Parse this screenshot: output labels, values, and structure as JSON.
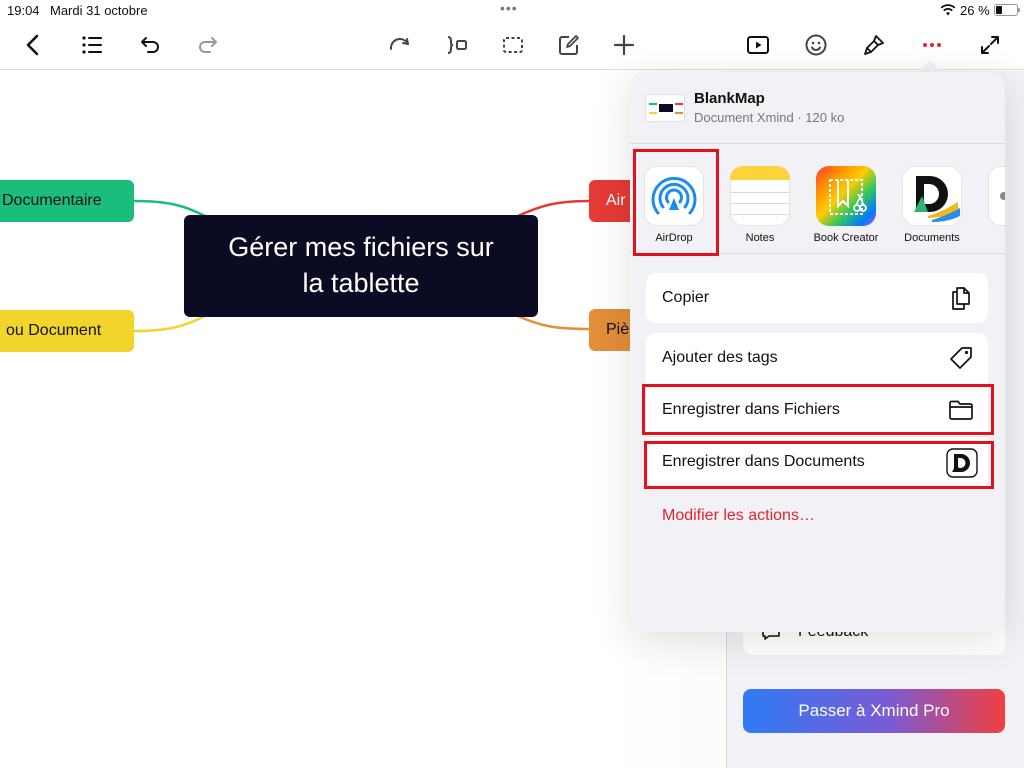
{
  "status_bar": {
    "time": "19:04",
    "date": "Mardi 31 octobre",
    "battery": "26 %"
  },
  "toolbar": {
    "icons": [
      "back-icon",
      "outline-icon",
      "undo-icon",
      "redo-icon",
      "relationship-icon",
      "summary-icon",
      "boundary-icon",
      "note-icon",
      "add-icon",
      "present-icon",
      "sticker-icon",
      "format-icon",
      "more-icon",
      "fullscreen-icon"
    ],
    "active_color": "#e0262d"
  },
  "mindmap": {
    "central": {
      "line1": "Gérer mes fichiers sur",
      "line2": "la tablette"
    },
    "branches": [
      {
        "label": "Documentaire",
        "color": "#1bbd7d"
      },
      {
        "label": "ou Document",
        "color": "#f2d52a"
      },
      {
        "label": "Air",
        "color": "#e53a35"
      },
      {
        "label": "Piè",
        "color": "#e38e3a"
      }
    ]
  },
  "side_panel": {
    "feedback": "Feedback",
    "pro_button": "Passer à Xmind Pro"
  },
  "share_sheet": {
    "file_name": "BlankMap",
    "file_meta": "Document Xmind · 120 ko",
    "apps": [
      {
        "label": "AirDrop",
        "icon": "airdrop-icon"
      },
      {
        "label": "Notes",
        "icon": "notes-icon"
      },
      {
        "label": "Book Creator",
        "icon": "book-creator-icon"
      },
      {
        "label": "Documents",
        "icon": "documents-icon"
      }
    ],
    "actions": [
      {
        "label": "Copier",
        "icon": "copy-icon"
      },
      {
        "label": "Ajouter des tags",
        "icon": "tag-icon"
      },
      {
        "label": "Enregistrer dans Fichiers",
        "icon": "folder-icon"
      },
      {
        "label": "Enregistrer dans Documents",
        "icon": "documents-app-icon"
      }
    ],
    "edit_actions": "Modifier les actions…"
  },
  "highlight_color": "#e3101e"
}
